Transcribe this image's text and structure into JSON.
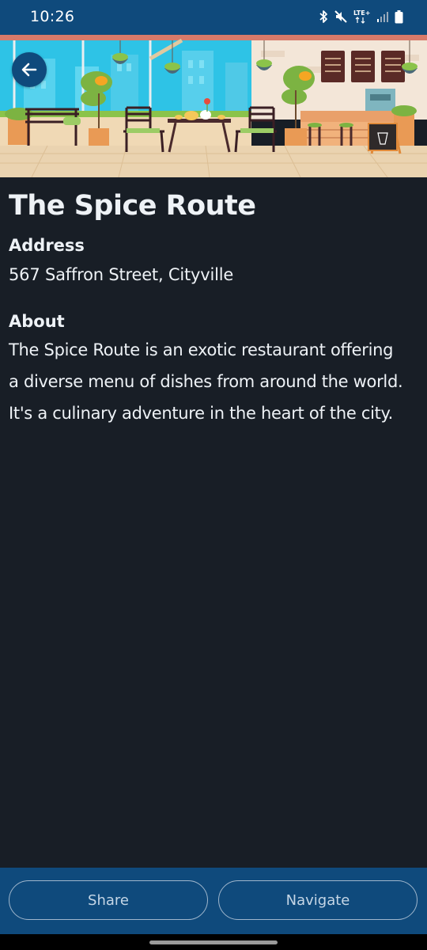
{
  "status_bar": {
    "time": "10:26",
    "network_label": "LTE+",
    "icons": [
      "bluetooth-icon",
      "mute-icon",
      "lte-icon",
      "signal-icon",
      "battery-icon"
    ]
  },
  "hero": {
    "image": "restaurant-terrace-illustration",
    "back_icon": "arrow-left-icon"
  },
  "restaurant": {
    "name": "The Spice Route",
    "address_heading": "Address",
    "address": "567 Saffron Street, Cityville",
    "about_heading": "About",
    "about_lines": [
      "The Spice Route is an exotic restaurant offering",
      "a diverse menu of dishes from around the world.",
      "It's a culinary adventure in the heart of the city."
    ]
  },
  "actions": {
    "share_label": "Share",
    "navigate_label": "Navigate"
  },
  "colors": {
    "background": "#181e26",
    "primary": "#0f4a7c",
    "text": "#eef2f6",
    "button_text": "#c5d6e6"
  }
}
